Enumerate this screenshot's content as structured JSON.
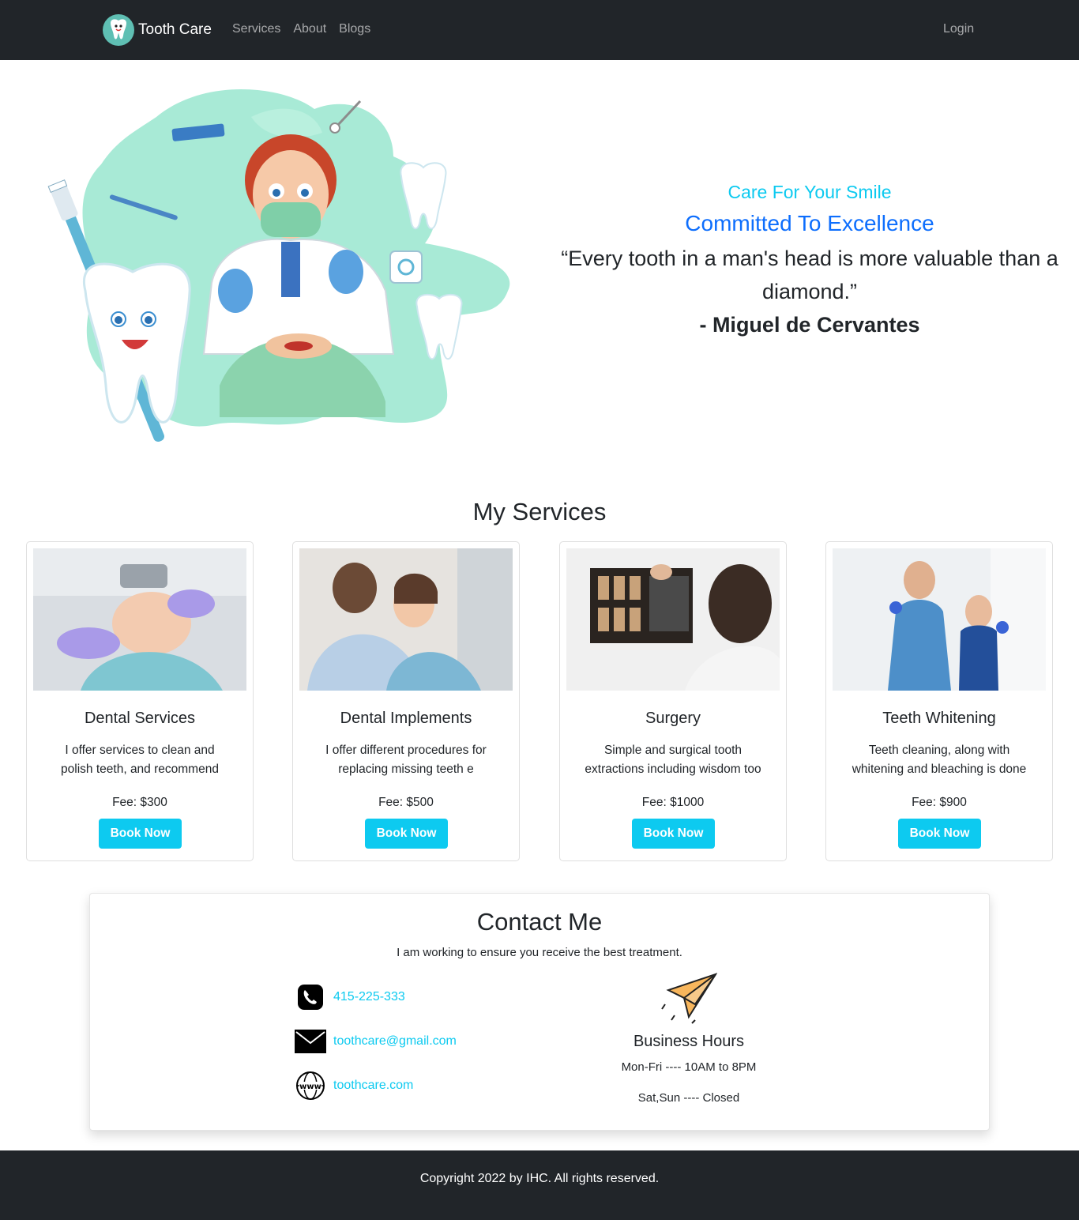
{
  "navbar": {
    "brand": "Tooth Care",
    "links": [
      "Services",
      "About",
      "Blogs"
    ],
    "login": "Login"
  },
  "hero": {
    "subtitle": "Care For Your Smile",
    "title": "Committed To Excellence",
    "quote": "“Every tooth in a man's head is more valuable than a diamond.”",
    "author": "- Miguel de Cervantes"
  },
  "services": {
    "heading": "My Services",
    "items": [
      {
        "title": "Dental Services",
        "description": "I offer services to clean and polish teeth, and recommend",
        "fee": "Fee: $300",
        "button": "Book Now"
      },
      {
        "title": "Dental Implements",
        "description": "I offer different procedures for replacing missing teeth e",
        "fee": "Fee: $500",
        "button": "Book Now"
      },
      {
        "title": "Surgery",
        "description": "Simple and surgical tooth extractions including wisdom too",
        "fee": "Fee: $1000",
        "button": "Book Now"
      },
      {
        "title": "Teeth Whitening",
        "description": "Teeth cleaning, along with whitening and bleaching is done",
        "fee": "Fee: $900",
        "button": "Book Now"
      }
    ]
  },
  "contact": {
    "title": "Contact Me",
    "subtitle": "I am working to ensure you receive the best treatment.",
    "phone": "415-225-333",
    "email": "toothcare@gmail.com",
    "website": "toothcare.com",
    "hours_title": "Business Hours",
    "hours": [
      "Mon-Fri ---- 10AM to 8PM",
      "Sat,Sun ---- Closed"
    ]
  },
  "footer": {
    "copyright": "Copyright 2022 by IHC. All rights reserved."
  },
  "colors": {
    "navbar": "#212529",
    "accent": "#0dcaf0",
    "primary": "#0d6efd"
  }
}
